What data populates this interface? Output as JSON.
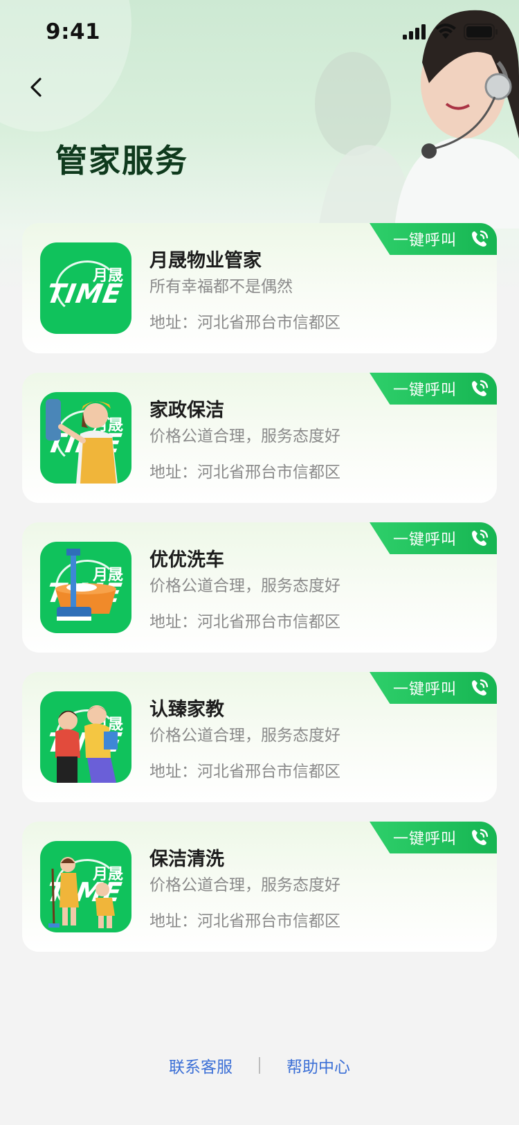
{
  "status_bar": {
    "time": "9:41"
  },
  "header": {
    "title": "管家服务"
  },
  "services": [
    {
      "name": "月晟物业管家",
      "slogan": "所有幸福都不是偶然",
      "address": "地址：河北省邢台市信都区",
      "call_label": "一键呼叫",
      "thumb": "time-logo"
    },
    {
      "name": "家政保洁",
      "slogan": "价格公道合理，服务态度好",
      "address": "地址：河北省邢台市信都区",
      "call_label": "一键呼叫",
      "thumb": "cleaning-woman"
    },
    {
      "name": "优优洗车",
      "slogan": "价格公道合理，服务态度好",
      "address": "地址：河北省邢台市信都区",
      "call_label": "一键呼叫",
      "thumb": "wash-basin"
    },
    {
      "name": "认臻家教",
      "slogan": "价格公道合理，服务态度好",
      "address": "地址：河北省邢台市信都区",
      "call_label": "一键呼叫",
      "thumb": "students"
    },
    {
      "name": "保洁清洗",
      "slogan": "价格公道合理，服务态度好",
      "address": "地址：河北省邢台市信都区",
      "call_label": "一键呼叫",
      "thumb": "cleaners"
    }
  ],
  "thumb_logo": {
    "cn": "月晟",
    "en": "TIME"
  },
  "footer": {
    "contact": "联系客服",
    "help": "帮助中心"
  },
  "colors": {
    "accent": "#16b552",
    "thumb_bg": "#10c25c",
    "link": "#3b6fd6",
    "title": "#0f3a1d"
  }
}
